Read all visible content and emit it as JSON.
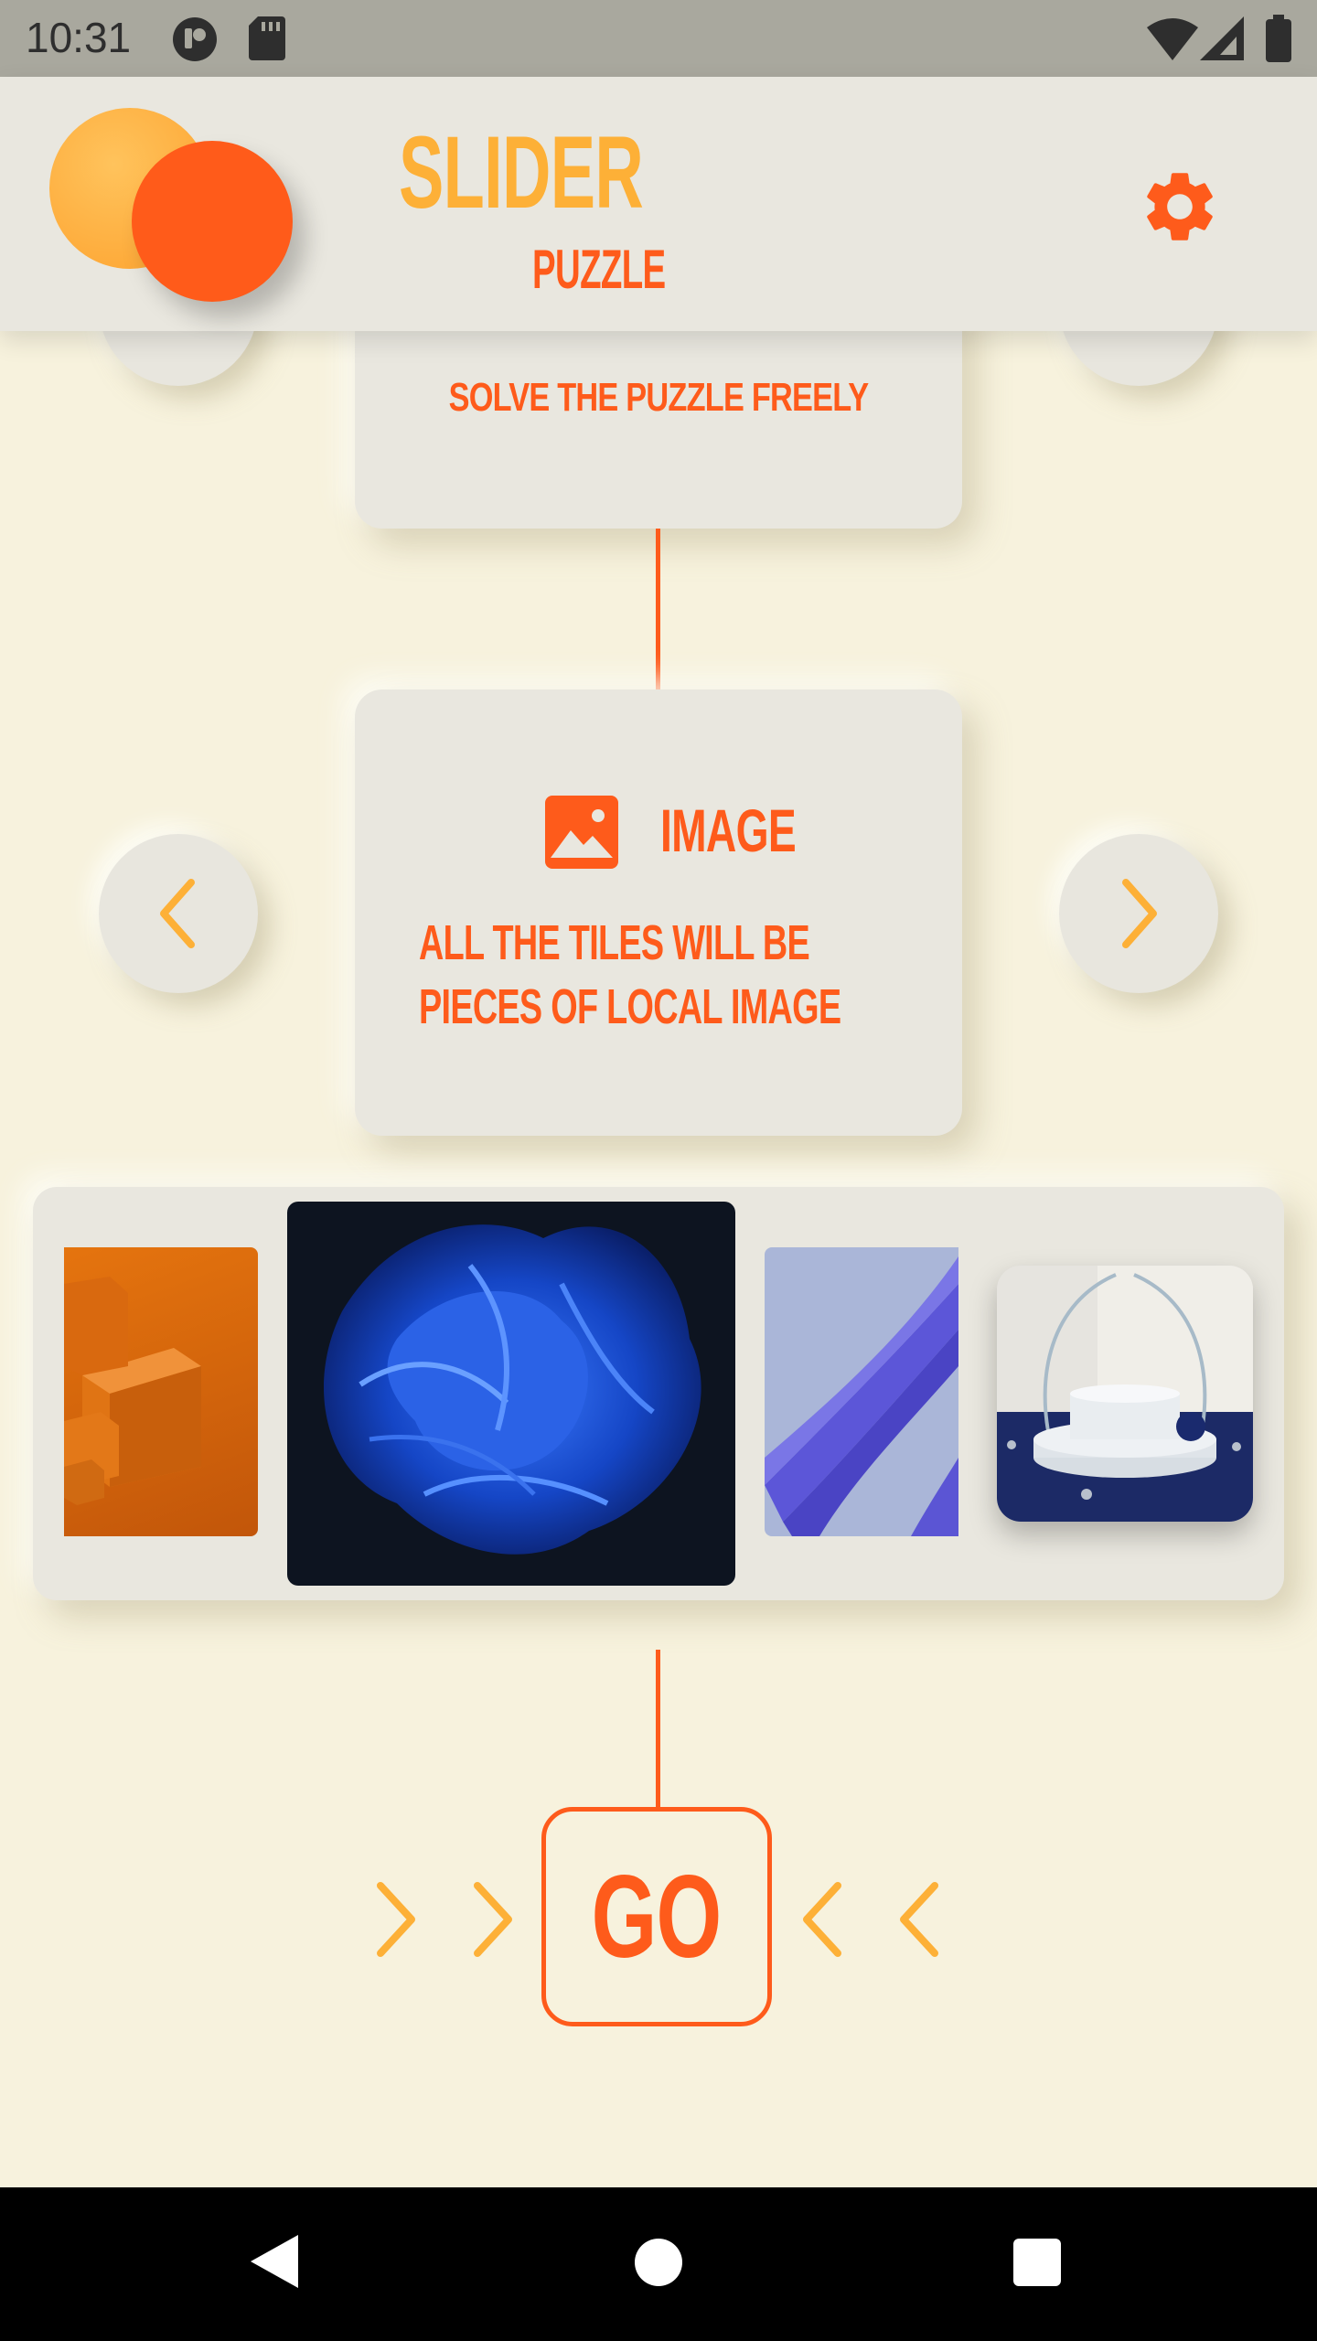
{
  "status_bar": {
    "time": "10:31"
  },
  "header": {
    "title": "SLIDER",
    "subtitle": "PUZZLE"
  },
  "mode_prev": {
    "description": "SOLVE THE PUZZLE FREELY"
  },
  "mode_current": {
    "title": "IMAGE",
    "description_line1": "ALL THE TILES WILL BE",
    "description_line2": "PIECES OF LOCAL IMAGE"
  },
  "carousel": {
    "images": [
      "orange-cubes-image",
      "blue-abstract-flower-image",
      "purple-waves-image",
      "white-podium-image"
    ]
  },
  "go_button": {
    "label": "GO"
  },
  "colors": {
    "accent_orange": "#fe5b1b",
    "accent_yellow": "#fdb037",
    "background": "#f7f2dd",
    "card": "#e9e7df"
  }
}
